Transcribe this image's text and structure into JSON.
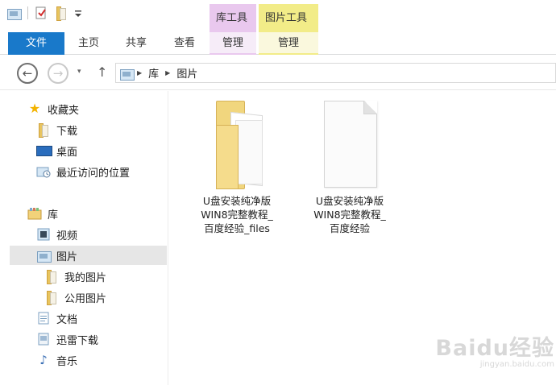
{
  "context_tabs": {
    "library_tools": "库工具",
    "picture_tools": "图片工具"
  },
  "ribbon": {
    "file": "文件",
    "home": "主页",
    "share": "共享",
    "view": "查看",
    "manage_library": "管理",
    "manage_picture": "管理"
  },
  "navigation": {
    "back_glyph": "←",
    "forward_glyph": "→",
    "recent_glyph": "▾",
    "up_glyph": "↑"
  },
  "address": {
    "crumbs": [
      "库",
      "图片"
    ]
  },
  "sidebar": {
    "favorites": {
      "label": "收藏夹",
      "items": [
        {
          "label": "下载",
          "icon": "folder-icon"
        },
        {
          "label": "桌面",
          "icon": "monitor-icon"
        },
        {
          "label": "最近访问的位置",
          "icon": "recent-icon"
        }
      ]
    },
    "libraries": {
      "label": "库",
      "items": [
        {
          "label": "视频",
          "icon": "video-library-icon"
        },
        {
          "label": "图片",
          "icon": "picture-library-icon",
          "selected": true
        },
        {
          "label": "我的图片",
          "icon": "folder-icon"
        },
        {
          "label": "公用图片",
          "icon": "folder-icon"
        },
        {
          "label": "文档",
          "icon": "document-library-icon"
        },
        {
          "label": "迅雷下载",
          "icon": "download-library-icon"
        },
        {
          "label": "音乐",
          "icon": "music-icon"
        }
      ]
    }
  },
  "files": [
    {
      "line1": "U盘安装纯净版",
      "line2": "WIN8完整教程_",
      "line3": "百度经验_files",
      "type": "folder"
    },
    {
      "line1": "U盘安装纯净版",
      "line2": "WIN8完整教程_",
      "line3": "百度经验",
      "type": "document"
    }
  ],
  "watermark": {
    "brand": "Baidu经验",
    "url": "jingyan.baidu.com"
  },
  "colors": {
    "file_tab": "#1979ca",
    "library_tools": "#e9c8ee",
    "picture_tools": "#f2ec88",
    "selected_item": "#e6e6e6",
    "folder": "#f2d27a"
  }
}
